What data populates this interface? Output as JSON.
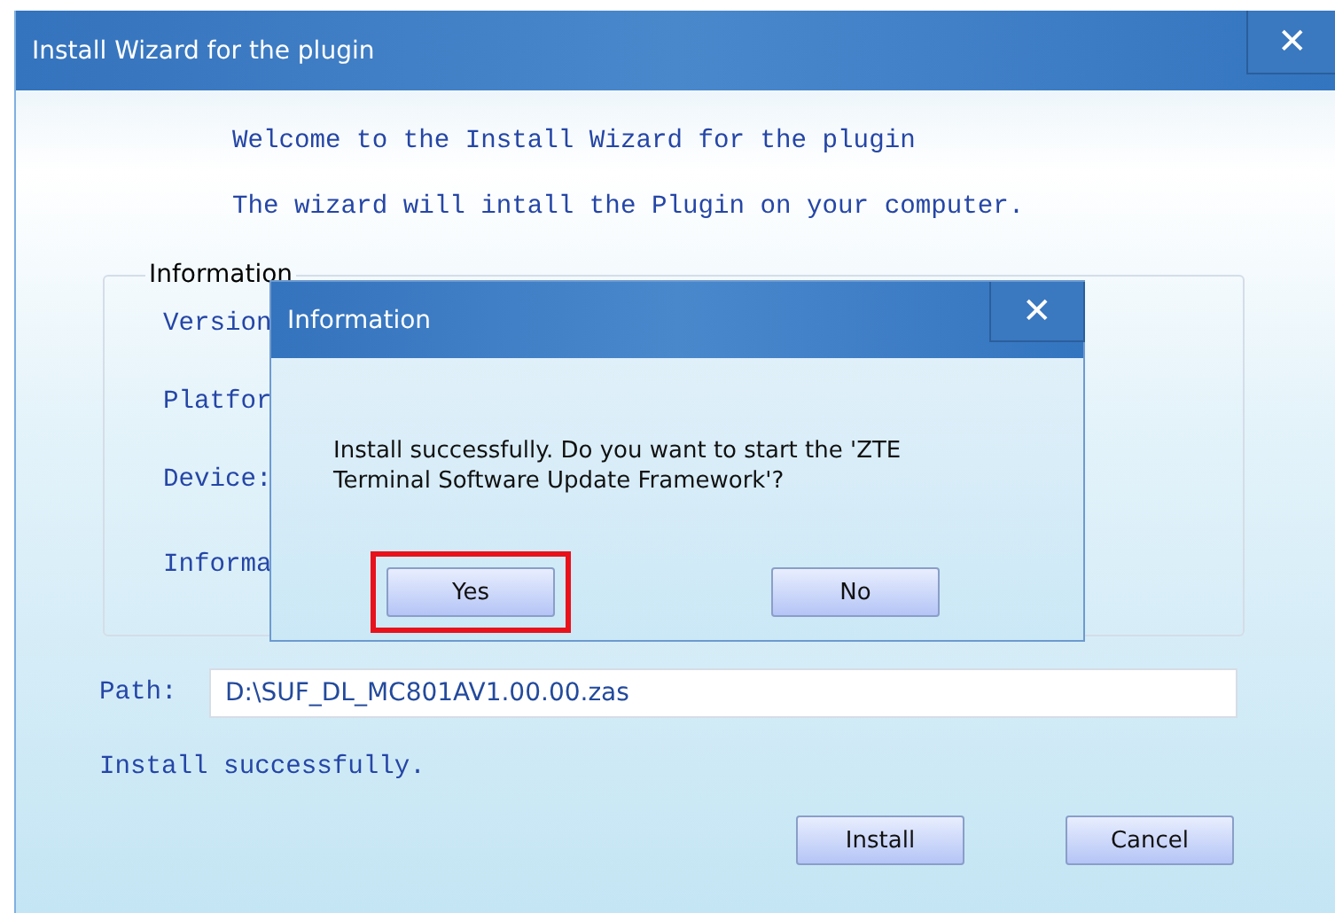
{
  "window": {
    "title": "Install Wizard for the plugin",
    "close": "✕"
  },
  "intro": [
    "Welcome to the Install Wizard for the plugin",
    "The wizard will intall the Plugin on your computer."
  ],
  "information": {
    "title": "Information",
    "fields": [
      "Version",
      "Platfor",
      "Device:",
      "Informa"
    ]
  },
  "path": {
    "label": "Path:",
    "value": "D:\\SUF_DL_MC801AV1.00.00.zas"
  },
  "status": "Install successfully.",
  "buttons": [
    {
      "label": "Install"
    },
    {
      "label": "Cancel"
    }
  ],
  "dialog": {
    "title": "Information",
    "close": "✕",
    "message": "Install successfully. Do you want to start the 'ZTE Terminal Software Update Framework'?",
    "buttons": [
      {
        "label": "Yes",
        "highlighted": true
      },
      {
        "label": "No",
        "highlighted": false
      }
    ]
  }
}
